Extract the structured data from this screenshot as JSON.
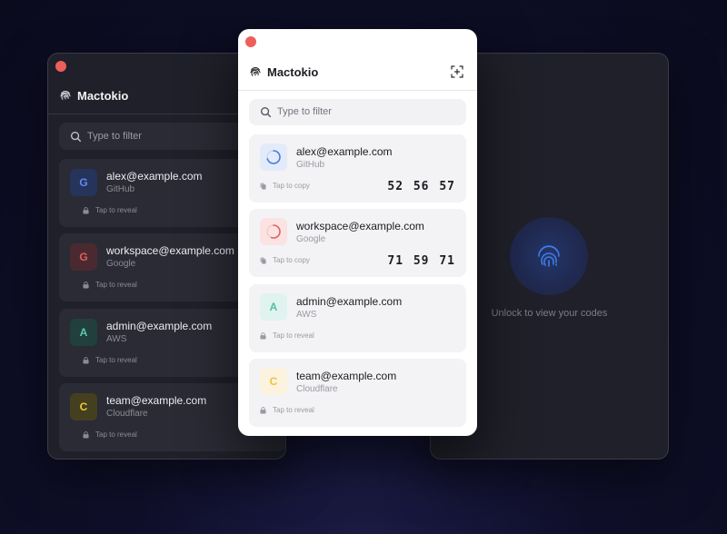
{
  "app": {
    "title": "Mactokio"
  },
  "search": {
    "placeholder": "Type to filter"
  },
  "locked_hint": "Unlock to view your codes",
  "left_window": {
    "accounts": [
      {
        "letter": "G",
        "email": "alex@example.com",
        "service": "GitHub",
        "action": "Tap to reveal",
        "avatar_bg": "#26335a",
        "avatar_fg": "#5b8cf0"
      },
      {
        "letter": "G",
        "email": "workspace@example.com",
        "service": "Google",
        "action": "Tap to reveal",
        "avatar_bg": "#4a2a30",
        "avatar_fg": "#e25c5c"
      },
      {
        "letter": "A",
        "email": "admin@example.com",
        "service": "AWS",
        "action": "Tap to reveal",
        "avatar_bg": "#21403d",
        "avatar_fg": "#5ec9b0"
      },
      {
        "letter": "C",
        "email": "team@example.com",
        "service": "Cloudflare",
        "action": "Tap to reveal",
        "avatar_bg": "#44401f",
        "avatar_fg": "#f0c63c"
      }
    ]
  },
  "center_window": {
    "accounts": [
      {
        "email": "alex@example.com",
        "service": "GitHub",
        "action": "Tap to copy",
        "code": "52 56 57",
        "avatar_bg": "#e3ebfa",
        "ring_color": "#4a7be0",
        "remaining": 0.7
      },
      {
        "email": "workspace@example.com",
        "service": "Google",
        "action": "Tap to copy",
        "code": "71 59 71",
        "avatar_bg": "#fbe3e3",
        "ring_color": "#e06363",
        "remaining": 0.55
      },
      {
        "letter": "A",
        "email": "admin@example.com",
        "service": "AWS",
        "action": "Tap to reveal",
        "avatar_bg": "#e1f3ef",
        "avatar_fg": "#4fc1a6"
      },
      {
        "letter": "C",
        "email": "team@example.com",
        "service": "Cloudflare",
        "action": "Tap to reveal",
        "avatar_bg": "#fbf3dd",
        "avatar_fg": "#efc23a"
      }
    ]
  },
  "colors": {
    "close": "#ec5f5b",
    "accent": "#3f7be8"
  }
}
